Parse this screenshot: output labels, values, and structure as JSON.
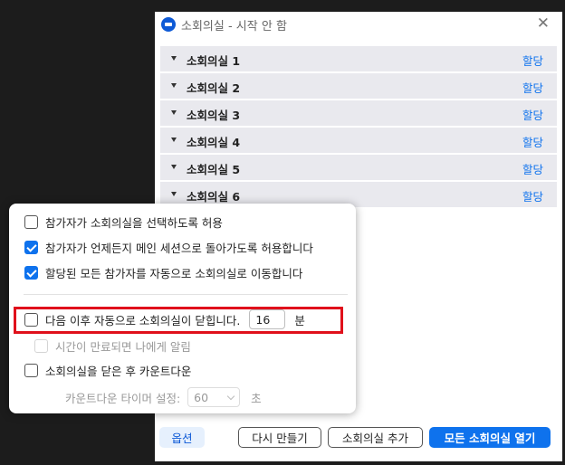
{
  "window": {
    "title": "소회의실 - 시작 안 함",
    "close_glyph": "✕"
  },
  "rooms": [
    {
      "name": "소회의실 1",
      "action": "할당"
    },
    {
      "name": "소회의실 2",
      "action": "할당"
    },
    {
      "name": "소회의실 3",
      "action": "할당"
    },
    {
      "name": "소회의실 4",
      "action": "할당"
    },
    {
      "name": "소회의실 5",
      "action": "할당"
    },
    {
      "name": "소회의실 6",
      "action": "할당"
    }
  ],
  "options": {
    "allow_choose": {
      "label": "참가자가 소회의실을 선택하도록 허용",
      "checked": false
    },
    "allow_return": {
      "label": "참가자가 언제든지 메인 세션으로 돌아가도록 허용합니다",
      "checked": true
    },
    "auto_move": {
      "label": "할당된 모든 참가자를 자동으로 소회의실로 이동합니다",
      "checked": true
    },
    "auto_close": {
      "label": "다음 이후 자동으로 소회의실이 닫힙니다.",
      "checked": false,
      "minutes": "16",
      "unit": "분"
    },
    "notify": {
      "label": "시간이 만료되면 나에게 알림",
      "checked": false
    },
    "countdown": {
      "label": "소회의실을 닫은 후 카운트다운",
      "checked": false
    },
    "timer": {
      "label": "카운트다운 타이머 설정:",
      "value": "60",
      "unit": "초"
    }
  },
  "footer": {
    "options": "옵션",
    "recreate": "다시 만들기",
    "add_room": "소회의실 추가",
    "open_all": "모든 소회의실 열기"
  },
  "colors": {
    "accent": "#0e72ed",
    "highlight": "#e0101b"
  }
}
